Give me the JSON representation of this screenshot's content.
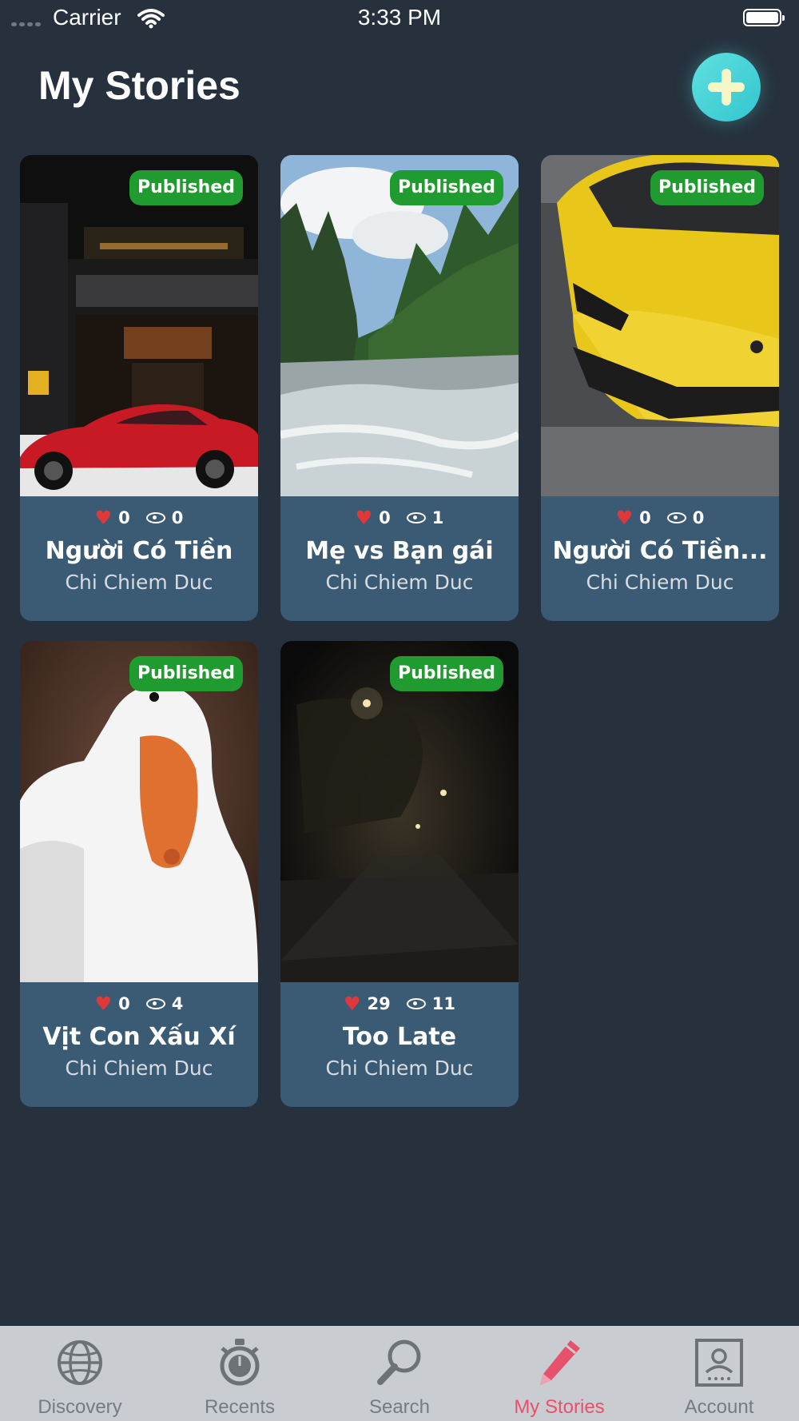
{
  "status_bar": {
    "carrier": "Carrier",
    "time": "3:33 PM"
  },
  "header": {
    "title": "My Stories",
    "add_icon": "plus-icon"
  },
  "colors": {
    "background": "#26313d",
    "card": "#3b5a73",
    "badge": "#1f9b2f",
    "accent": "#e8516b",
    "add_button": "#4fd6da"
  },
  "stories": [
    {
      "title": "Người Có Tiền",
      "author": "Chi Chiem Duc",
      "status": "Published",
      "likes": "0",
      "views": "0"
    },
    {
      "title": "Mẹ vs Bạn gái",
      "author": "Chi Chiem Duc",
      "status": "Published",
      "likes": "0",
      "views": "1"
    },
    {
      "title": "Người Có Tiền...",
      "author": "Chi Chiem Duc",
      "status": "Published",
      "likes": "0",
      "views": "0"
    },
    {
      "title": "Vịt Con Xấu Xí",
      "author": "Chi Chiem Duc",
      "status": "Published",
      "likes": "0",
      "views": "4"
    },
    {
      "title": "Too Late",
      "author": "Chi Chiem Duc",
      "status": "Published",
      "likes": "29",
      "views": "11"
    }
  ],
  "tabs": [
    {
      "label": "Discovery",
      "icon": "globe-icon",
      "active": false
    },
    {
      "label": "Recents",
      "icon": "stopwatch-icon",
      "active": false
    },
    {
      "label": "Search",
      "icon": "magnifier-icon",
      "active": false
    },
    {
      "label": "My Stories",
      "icon": "pencil-icon",
      "active": true
    },
    {
      "label": "Account",
      "icon": "account-icon",
      "active": false
    }
  ]
}
